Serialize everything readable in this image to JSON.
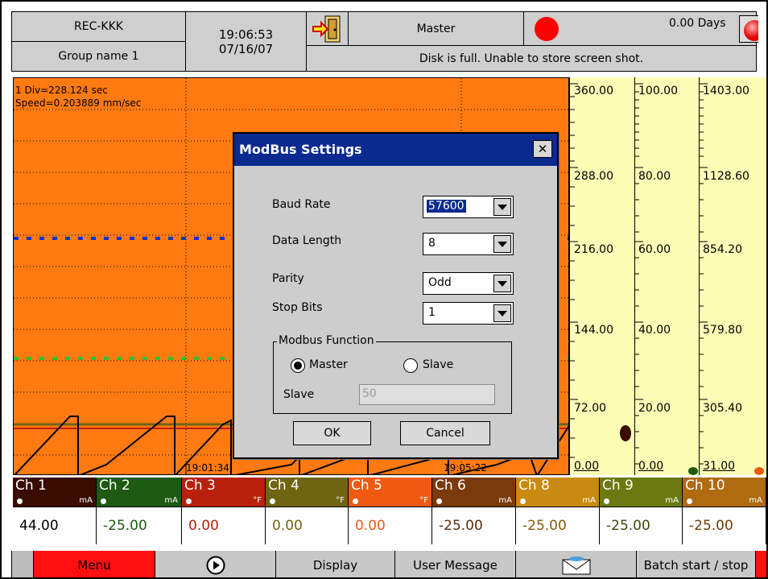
{
  "header": {
    "recorder_name": "REC-KKK",
    "group_name": "Group name 1",
    "time": "19:06:53",
    "date": "07/16/07",
    "mode": "Master",
    "days": "0.00 Days",
    "status_message": "Disk is full. Unable to store screen shot."
  },
  "chart": {
    "div_info": "1 Div=228.124 sec",
    "speed_info": "Speed=0.203889 mm/sec",
    "time_marks": [
      "19:01:34",
      "19:05:22"
    ]
  },
  "scales": [
    {
      "ticks": [
        "360.00",
        "288.00",
        "216.00",
        "144.00",
        "72.00",
        "0.00"
      ]
    },
    {
      "ticks": [
        "100.00",
        "80.00",
        "60.00",
        "40.00",
        "20.00",
        "0.00"
      ]
    },
    {
      "ticks": [
        "1403.00",
        "1128.60",
        "854.20",
        "579.80",
        "305.40",
        "31.00"
      ]
    }
  ],
  "channels": [
    {
      "name": "Ch 1",
      "unit": "mA",
      "value": "44.00",
      "color": "#3a0c00",
      "value_color": "#000000"
    },
    {
      "name": "Ch 2",
      "unit": "mA",
      "value": "-25.00",
      "color": "#1e5a12",
      "value_color": "#1e5a12"
    },
    {
      "name": "Ch 3",
      "unit": "°F",
      "value": "0.00",
      "color": "#b8200c",
      "value_color": "#b8200c"
    },
    {
      "name": "Ch 4",
      "unit": "°F",
      "value": "0.00",
      "color": "#6f6410",
      "value_color": "#6f6410"
    },
    {
      "name": "Ch 5",
      "unit": "°F",
      "value": "0.00",
      "color": "#f05a10",
      "value_color": "#f05a10"
    },
    {
      "name": "Ch 6",
      "unit": "mA",
      "value": "-25.00",
      "color": "#7a3a0a",
      "value_color": "#5a2a08"
    },
    {
      "name": "Ch 8",
      "unit": "mA",
      "value": "-25.00",
      "color": "#c88a10",
      "value_color": "#8a5a08"
    },
    {
      "name": "Ch 9",
      "unit": "mA",
      "value": "-25.00",
      "color": "#6a7a10",
      "value_color": "#3a4a08"
    },
    {
      "name": "Ch 10",
      "unit": "mA",
      "value": "-25.00",
      "color": "#b06a10",
      "value_color": "#6a3a08"
    }
  ],
  "toolbar": {
    "menu": "Menu",
    "display": "Display",
    "user_message": "User Message",
    "batch": "Batch start / stop"
  },
  "dialog": {
    "title": "ModBus Settings",
    "close": "✕",
    "baud_rate_label": "Baud Rate",
    "baud_rate_value": "57600",
    "data_length_label": "Data Length",
    "data_length_value": "8",
    "parity_label": "Parity",
    "parity_value": "Odd",
    "stop_bits_label": "Stop Bits",
    "stop_bits_value": "1",
    "function_group": "Modbus Function",
    "master_label": "Master",
    "slave_label": "Slave",
    "master_selected": true,
    "slave_id_label": "Slave",
    "slave_id_value": "50",
    "ok": "OK",
    "cancel": "Cancel"
  },
  "colors": {
    "chart_bg": "#ff7a10",
    "scale_bg": "#fdfdb6",
    "dialog_title": "#0a2a8f",
    "record_dot": "#ff0000",
    "menu_button": "#ff1010"
  }
}
